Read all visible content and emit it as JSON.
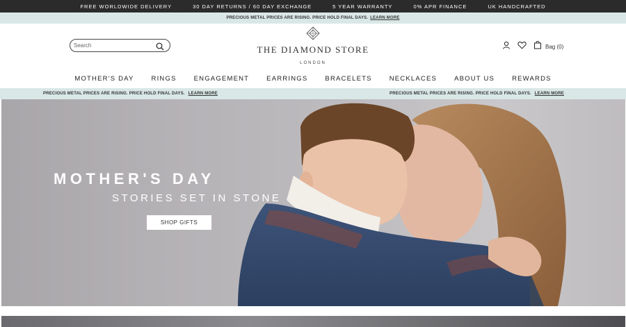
{
  "top_bar": {
    "items": [
      "FREE WORLDWIDE DELIVERY",
      "30 DAY RETURNS / 60 DAY EXCHANGE",
      "5 YEAR WARRANTY",
      "0% APR FINANCE",
      "UK HANDCRAFTED"
    ]
  },
  "promo": {
    "text": "PRECIOUS METAL PRICES ARE RISING. PRICE HOLD FINAL DAYS.",
    "link": "LEARN MORE"
  },
  "header": {
    "search_placeholder": "Search",
    "logo_name": "THE DIAMOND STORE",
    "logo_city": "LONDON",
    "bag_label": "Bag (0)"
  },
  "nav": {
    "items": [
      "MOTHER'S DAY",
      "RINGS",
      "ENGAGEMENT",
      "EARRINGS",
      "BRACELETS",
      "NECKLACES",
      "ABOUT US",
      "REWARDS"
    ]
  },
  "hero": {
    "title": "MOTHER'S DAY",
    "subtitle": "STORIES SET IN STONE",
    "button": "SHOP GIFTS"
  },
  "colors": {
    "top_bar_bg": "#2b2b2b",
    "promo_bg": "#d9e8e6",
    "hero_text": "#ffffff"
  },
  "icons": [
    "search-icon",
    "diamond-logo-icon",
    "account-icon",
    "heart-icon",
    "bag-icon"
  ]
}
